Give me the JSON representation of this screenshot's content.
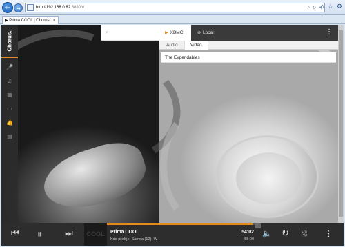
{
  "browser": {
    "back_icon": "back-arrow-icon",
    "forward_icon": "forward-arrow-icon",
    "url_host": "http://192.168.0.82",
    "url_rest": ":8080/#",
    "address_tools": [
      "search-icon",
      "refresh-icon",
      "stop-icon"
    ],
    "window_tools": [
      "home-icon",
      "favorites-star-icon",
      "settings-gear-icon"
    ],
    "tab": {
      "title": "▶ Prima COOL | Chorus.",
      "close": "×"
    }
  },
  "app": {
    "brand": "Chorus.",
    "accent_color": "#e58a1f",
    "nav_items": [
      {
        "name": "microphone-icon",
        "glyph": "🎤"
      },
      {
        "name": "music-note-icon",
        "glyph": "♫"
      },
      {
        "name": "film-icon",
        "glyph": "▦"
      },
      {
        "name": "tv-icon",
        "glyph": "▭"
      },
      {
        "name": "thumbs-up-icon",
        "glyph": "👍"
      },
      {
        "name": "list-icon",
        "glyph": "▤"
      }
    ],
    "search": {
      "icon": "search-icon",
      "placeholder": ""
    },
    "panel": {
      "tabs": [
        {
          "label": "XBMC",
          "icon": "play-triangle-icon",
          "active": true
        },
        {
          "label": "Local",
          "icon": "browser-icon",
          "active": false
        }
      ],
      "sub_tabs": [
        {
          "label": "Audio",
          "active": false
        },
        {
          "label": "Video",
          "active": true
        }
      ],
      "playlist": [
        "The Expendables"
      ]
    },
    "player": {
      "prev_icon": "previous-icon",
      "pause_icon": "pause-icon",
      "next_icon": "next-icon",
      "thumb_text": "COOL",
      "title": "Prima COOL",
      "subtitle": "Kdo přežije: Samoa (12) -W",
      "elapsed": "54:02",
      "total": "55:00",
      "progress_fraction": 0.98,
      "volume_icon": "volume-icon",
      "repeat_icon": "repeat-icon",
      "shuffle_icon": "shuffle-icon",
      "more_icon": "more-vertical-icon"
    }
  }
}
